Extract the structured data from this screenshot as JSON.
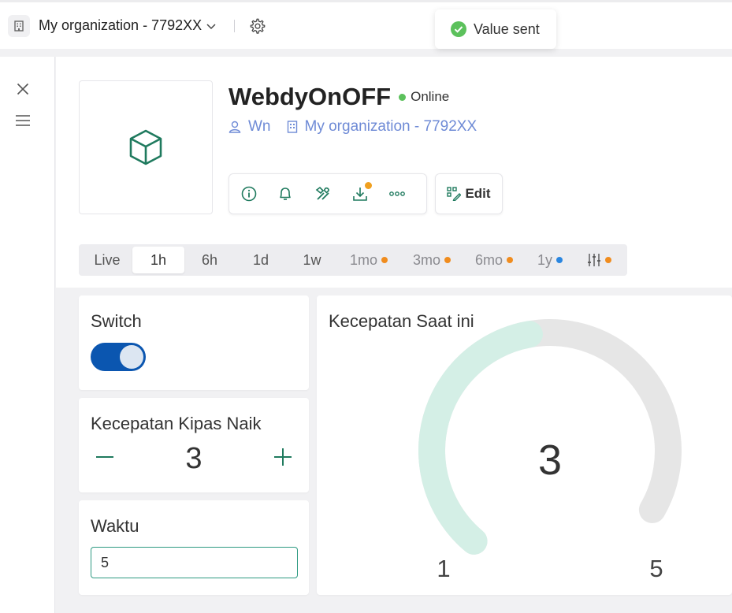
{
  "topbar": {
    "org_name": "My organization - 7792XX"
  },
  "toast": {
    "text": "Value sent"
  },
  "device": {
    "name": "WebdyOnOFF",
    "status": "Online",
    "owner": "Wn",
    "organization": "My organization - 7792XX",
    "edit_label": "Edit"
  },
  "time_tabs": [
    {
      "label": "Live",
      "active": false,
      "muted": false,
      "dot": ""
    },
    {
      "label": "1h",
      "active": true,
      "muted": false,
      "dot": ""
    },
    {
      "label": "6h",
      "active": false,
      "muted": false,
      "dot": ""
    },
    {
      "label": "1d",
      "active": false,
      "muted": false,
      "dot": ""
    },
    {
      "label": "1w",
      "active": false,
      "muted": false,
      "dot": ""
    },
    {
      "label": "1mo",
      "active": false,
      "muted": true,
      "dot": "#f08c1e"
    },
    {
      "label": "3mo",
      "active": false,
      "muted": true,
      "dot": "#f08c1e"
    },
    {
      "label": "6mo",
      "active": false,
      "muted": true,
      "dot": "#f08c1e"
    },
    {
      "label": "1y",
      "active": false,
      "muted": true,
      "dot": "#2a86e0"
    }
  ],
  "widgets": {
    "switch": {
      "title": "Switch",
      "on": true
    },
    "stepper": {
      "title": "Kecepatan Kipas Naik",
      "value": "3"
    },
    "input": {
      "title": "Waktu",
      "value": "5"
    },
    "gauge": {
      "title": "Kecepatan Saat ini",
      "value": 3,
      "min": 1,
      "max": 5,
      "value_label": "3",
      "min_label": "1",
      "max_label": "5"
    }
  },
  "colors": {
    "accent": "#1f7a5e",
    "gauge_fill": "#d4efe6",
    "gauge_track": "#e6e6e6",
    "toggle_on": "#0b56b0",
    "online": "#5cc15c",
    "link": "#6f8bd6",
    "badge": "#f0a020"
  },
  "icons": {
    "org": "building-icon",
    "settings": "gear-icon",
    "toast": "check-circle-icon",
    "close": "close-icon",
    "menu": "menu-icon",
    "device": "cube-icon",
    "owner": "user-icon",
    "info": "info-icon",
    "notifications": "bell-icon",
    "tools": "tools-icon",
    "download": "download-icon",
    "more": "more-icon",
    "edit": "edit-icon",
    "filters": "sliders-icon"
  }
}
